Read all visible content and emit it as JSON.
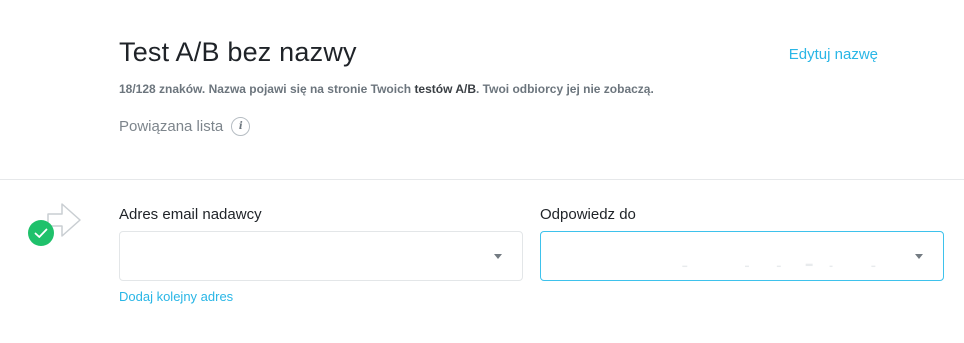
{
  "header": {
    "title": "Test A/B bez nazwy",
    "edit_label": "Edytuj nazwę",
    "hint_prefix": "18/128 znaków. Nazwa pojawi się na stronie Twoich ",
    "hint_strong": "testów A/B",
    "hint_suffix": ". Twoi odbiorcy jej nie zobaczą.",
    "related_list_label": "Powiązana lista",
    "info_icon_glyph": "i"
  },
  "sender": {
    "label": "Adres email nadawcy",
    "value": "",
    "add_address_label": "Dodaj kolejny adres"
  },
  "reply_to": {
    "label": "Odpowiedz do",
    "value": ""
  },
  "colors": {
    "accent": "#29b6e6",
    "success": "#1fc16b",
    "focus_border": "#3ec2ec"
  }
}
